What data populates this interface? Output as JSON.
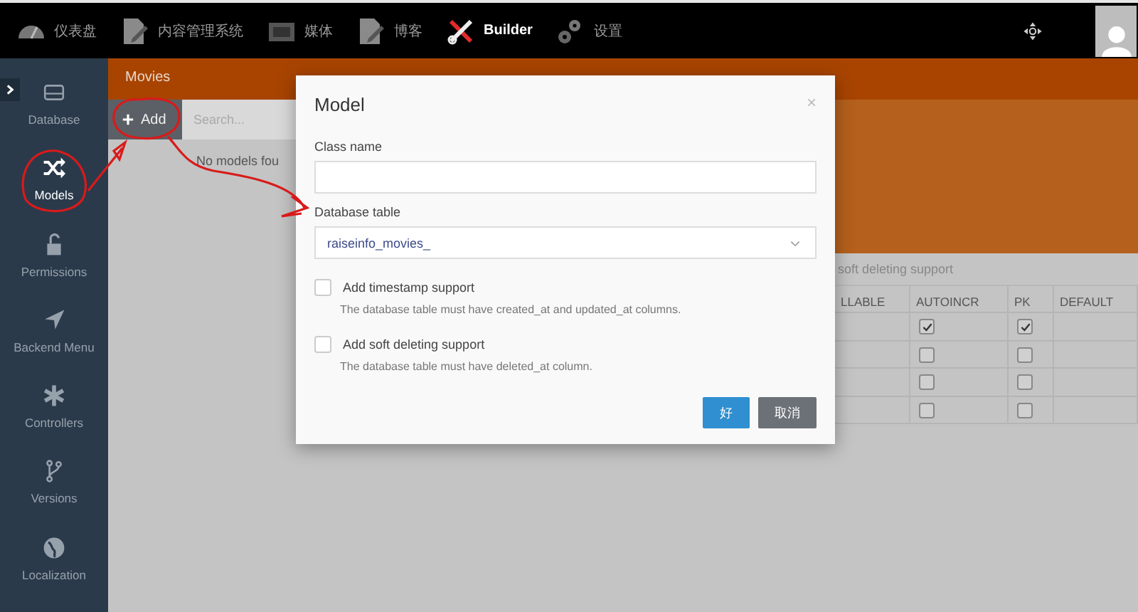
{
  "top_nav": {
    "items": [
      {
        "label": "仪表盘",
        "selected": false
      },
      {
        "label": "内容管理系统",
        "selected": false
      },
      {
        "label": "媒体",
        "selected": false
      },
      {
        "label": "博客",
        "selected": false
      },
      {
        "label": "Builder",
        "selected": true
      },
      {
        "label": "设置",
        "selected": false
      }
    ]
  },
  "sidebar": {
    "items": [
      {
        "label": "Database",
        "selected": false
      },
      {
        "label": "Models",
        "selected": true
      },
      {
        "label": "Permissions",
        "selected": false
      },
      {
        "label": "Backend Menu",
        "selected": false
      },
      {
        "label": "Controllers",
        "selected": false
      },
      {
        "label": "Versions",
        "selected": false
      },
      {
        "label": "Localization",
        "selected": false
      }
    ]
  },
  "panel": {
    "title": "Movies",
    "add_button": "Add",
    "search": {
      "placeholder": "Search..."
    },
    "empty_message": "No models fou"
  },
  "background_table": {
    "note": "soft deleting support",
    "columns": [
      "LLABLE",
      "AUTOINCR",
      "PK",
      "DEFAULT"
    ],
    "rows": [
      {
        "autoincr": true,
        "pk": true
      },
      {
        "autoincr": false,
        "pk": false
      },
      {
        "autoincr": false,
        "pk": false
      },
      {
        "autoincr": false,
        "pk": false
      }
    ]
  },
  "modal": {
    "title": "Model",
    "close": "×",
    "fields": [
      {
        "kind": "text",
        "label": "Class name"
      },
      {
        "kind": "select",
        "label": "Database table",
        "value": "raiseinfo_movies_"
      }
    ],
    "checkboxes": [
      {
        "label": "Add timestamp support",
        "hint": "The database table must have created_at and updated_at columns.",
        "checked": false
      },
      {
        "label": "Add soft deleting support",
        "hint": "The database table must have deleted_at column.",
        "checked": false
      }
    ],
    "buttons": [
      {
        "label": "好",
        "kind": "primary"
      },
      {
        "label": "取消",
        "kind": "secondary"
      }
    ]
  }
}
